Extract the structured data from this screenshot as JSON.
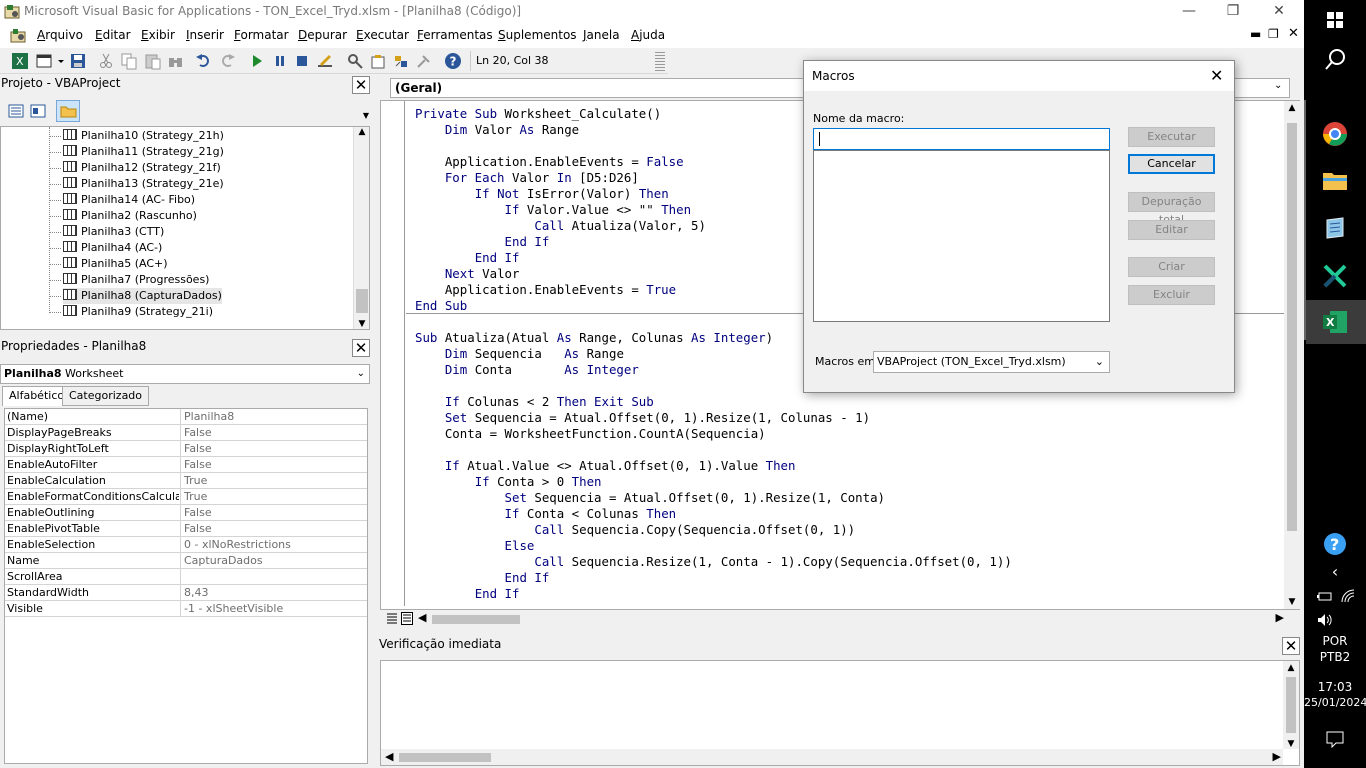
{
  "window": {
    "title": "Microsoft Visual Basic for Applications - TON_Excel_Tryd.xlsm - [Planilha8 (Código)]"
  },
  "menubar": {
    "items": [
      {
        "u": "A",
        "rest": "rquivo"
      },
      {
        "u": "E",
        "rest": "ditar"
      },
      {
        "u": "E",
        "rest": "xibir"
      },
      {
        "u": "I",
        "rest": "nserir"
      },
      {
        "u": "F",
        "rest": "ormatar"
      },
      {
        "u": "D",
        "rest": "epurar"
      },
      {
        "u": "E",
        "rest": "xecutar"
      },
      {
        "u": "F",
        "rest": "erramentas"
      },
      {
        "u": "S",
        "rest": "uplementos"
      },
      {
        "u": "J",
        "rest": "anela"
      },
      {
        "u": "A",
        "rest": "juda"
      }
    ]
  },
  "toolbar": {
    "position": "Ln 20, Col 38"
  },
  "project": {
    "title": "Projeto - VBAProject",
    "items": [
      "Planilha10 (Strategy_21h)",
      "Planilha11 (Strategy_21g)",
      "Planilha12 (Strategy_21f)",
      "Planilha13 (Strategy_21e)",
      "Planilha14 (AC- Fibo)",
      "Planilha2 (Rascunho)",
      "Planilha3 (CTT)",
      "Planilha4 (AC-)",
      "Planilha5 (AC+)",
      "Planilha7 (Progressões)",
      "Planilha8 (CapturaDados)",
      "Planilha9 (Strategy_21i)"
    ],
    "selected_index": 10
  },
  "properties": {
    "title": "Propriedades - Planilha8",
    "object_name": "Planilha8",
    "object_type": "Worksheet",
    "tabs": [
      "Alfabético",
      "Categorizado"
    ],
    "rows": [
      {
        "name": "(Name)",
        "value": "Planilha8"
      },
      {
        "name": "DisplayPageBreaks",
        "value": "False"
      },
      {
        "name": "DisplayRightToLeft",
        "value": "False"
      },
      {
        "name": "EnableAutoFilter",
        "value": "False"
      },
      {
        "name": "EnableCalculation",
        "value": "True"
      },
      {
        "name": "EnableFormatConditionsCalculation",
        "value": "True"
      },
      {
        "name": "EnableOutlining",
        "value": "False"
      },
      {
        "name": "EnablePivotTable",
        "value": "False"
      },
      {
        "name": "EnableSelection",
        "value": "0 - xlNoRestrictions"
      },
      {
        "name": "Name",
        "value": "CapturaDados"
      },
      {
        "name": "ScrollArea",
        "value": ""
      },
      {
        "name": "StandardWidth",
        "value": "8,43"
      },
      {
        "name": "Visible",
        "value": "-1 - xlSheetVisible"
      }
    ]
  },
  "code": {
    "object_combo": "(Geral)",
    "lines": [
      [
        [
          "kw",
          "Private Sub"
        ],
        [
          "t",
          " Worksheet_Calculate()"
        ]
      ],
      [
        [
          "t",
          "    "
        ],
        [
          "kw",
          "Dim"
        ],
        [
          "t",
          " Valor "
        ],
        [
          "kw",
          "As"
        ],
        [
          "t",
          " Range"
        ]
      ],
      [],
      [
        [
          "t",
          "    Application.EnableEvents = "
        ],
        [
          "kw",
          "False"
        ]
      ],
      [
        [
          "t",
          "    "
        ],
        [
          "kw",
          "For Each"
        ],
        [
          "t",
          " Valor "
        ],
        [
          "kw",
          "In"
        ],
        [
          "t",
          " [D5:D26]"
        ]
      ],
      [
        [
          "t",
          "        "
        ],
        [
          "kw",
          "If Not"
        ],
        [
          "t",
          " IsError(Valor) "
        ],
        [
          "kw",
          "Then"
        ]
      ],
      [
        [
          "t",
          "            "
        ],
        [
          "kw",
          "If"
        ],
        [
          "t",
          " Valor.Value <> \"\" "
        ],
        [
          "kw",
          "Then"
        ]
      ],
      [
        [
          "t",
          "                "
        ],
        [
          "kw",
          "Call"
        ],
        [
          "t",
          " Atualiza(Valor, 5)"
        ]
      ],
      [
        [
          "t",
          "            "
        ],
        [
          "kw",
          "End If"
        ]
      ],
      [
        [
          "t",
          "        "
        ],
        [
          "kw",
          "End If"
        ]
      ],
      [
        [
          "t",
          "    "
        ],
        [
          "kw",
          "Next"
        ],
        [
          "t",
          " Valor"
        ]
      ],
      [
        [
          "t",
          "    Application.EnableEvents = "
        ],
        [
          "kw",
          "True"
        ]
      ],
      [
        [
          "kw",
          "End Sub"
        ]
      ],
      [],
      [
        [
          "kw",
          "Sub"
        ],
        [
          "t",
          " Atualiza(Atual "
        ],
        [
          "kw",
          "As"
        ],
        [
          "t",
          " Range, Colunas "
        ],
        [
          "kw",
          "As Integer"
        ],
        [
          "t",
          ")"
        ]
      ],
      [
        [
          "t",
          "    "
        ],
        [
          "kw",
          "Dim"
        ],
        [
          "t",
          " Sequencia   "
        ],
        [
          "kw",
          "As"
        ],
        [
          "t",
          " Range"
        ]
      ],
      [
        [
          "t",
          "    "
        ],
        [
          "kw",
          "Dim"
        ],
        [
          "t",
          " Conta       "
        ],
        [
          "kw",
          "As Integer"
        ]
      ],
      [],
      [
        [
          "t",
          "    "
        ],
        [
          "kw",
          "If"
        ],
        [
          "t",
          " Colunas < 2 "
        ],
        [
          "kw",
          "Then Exit Sub"
        ]
      ],
      [
        [
          "t",
          "    "
        ],
        [
          "kw",
          "Set"
        ],
        [
          "t",
          " Sequencia = Atual.Offset(0, 1).Resize(1, Colunas - 1)"
        ]
      ],
      [
        [
          "t",
          "    Conta = WorksheetFunction.CountA(Sequencia)"
        ]
      ],
      [],
      [
        [
          "t",
          "    "
        ],
        [
          "kw",
          "If"
        ],
        [
          "t",
          " Atual.Value <> Atual.Offset(0, 1).Value "
        ],
        [
          "kw",
          "Then"
        ]
      ],
      [
        [
          "t",
          "        "
        ],
        [
          "kw",
          "If"
        ],
        [
          "t",
          " Conta > 0 "
        ],
        [
          "kw",
          "Then"
        ]
      ],
      [
        [
          "t",
          "            "
        ],
        [
          "kw",
          "Set"
        ],
        [
          "t",
          " Sequencia = Atual.Offset(0, 1).Resize(1, Conta)"
        ]
      ],
      [
        [
          "t",
          "            "
        ],
        [
          "kw",
          "If"
        ],
        [
          "t",
          " Conta < Colunas "
        ],
        [
          "kw",
          "Then"
        ]
      ],
      [
        [
          "t",
          "                "
        ],
        [
          "kw",
          "Call"
        ],
        [
          "t",
          " Sequencia.Copy(Sequencia.Offset(0, 1))"
        ]
      ],
      [
        [
          "t",
          "            "
        ],
        [
          "kw",
          "Else"
        ]
      ],
      [
        [
          "t",
          "                "
        ],
        [
          "kw",
          "Call"
        ],
        [
          "t",
          " Sequencia.Resize(1, Conta - 1).Copy(Sequencia.Offset(0, 1))"
        ]
      ],
      [
        [
          "t",
          "            "
        ],
        [
          "kw",
          "End If"
        ]
      ],
      [
        [
          "t",
          "        "
        ],
        [
          "kw",
          "End If"
        ]
      ]
    ]
  },
  "immediate": {
    "title": "Verificação imediata"
  },
  "dialog": {
    "title": "Macros",
    "name_label": "Nome da macro:",
    "name_value": "",
    "macros_in_label": "Macros em:",
    "macros_in_value": "VBAProject (TON_Excel_Tryd.xlsm)",
    "buttons": {
      "run": "Executar",
      "cancel": "Cancelar",
      "step": "Depuração total",
      "edit": "Editar",
      "create": "Criar",
      "delete": "Excluir"
    }
  },
  "taskbar": {
    "language": "POR",
    "layout": "PTB2",
    "time": "17:03",
    "date": "25/01/2024"
  },
  "colors": {
    "keyword": "#00007f",
    "accent": "#0078d7"
  }
}
